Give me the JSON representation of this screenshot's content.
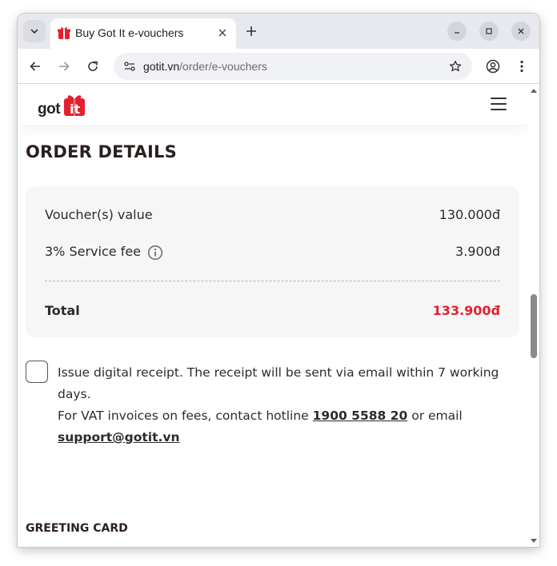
{
  "browser": {
    "tab_title": "Buy Got It e-vouchers",
    "url_host": "gotit.vn",
    "url_path": "/order/e-vouchers"
  },
  "site": {
    "logo_text": "got it"
  },
  "order": {
    "heading": "ORDER DETAILS",
    "voucher_label": "Voucher(s) value",
    "voucher_value": "130.000đ",
    "fee_label": "3% Service fee",
    "fee_value": "3.900đ",
    "total_label": "Total",
    "total_value": "133.900đ"
  },
  "receipt": {
    "line1": "Issue digital receipt. The receipt will be sent via email within 7 working days.",
    "vat_prefix": "For VAT invoices on fees, contact hotline ",
    "hotline": "1900 5588 20",
    "vat_middle": " or email ",
    "email": "support@gotit.vn"
  },
  "greeting": {
    "heading": "GREETING CARD"
  },
  "colors": {
    "accent_red": "#e4202e"
  }
}
